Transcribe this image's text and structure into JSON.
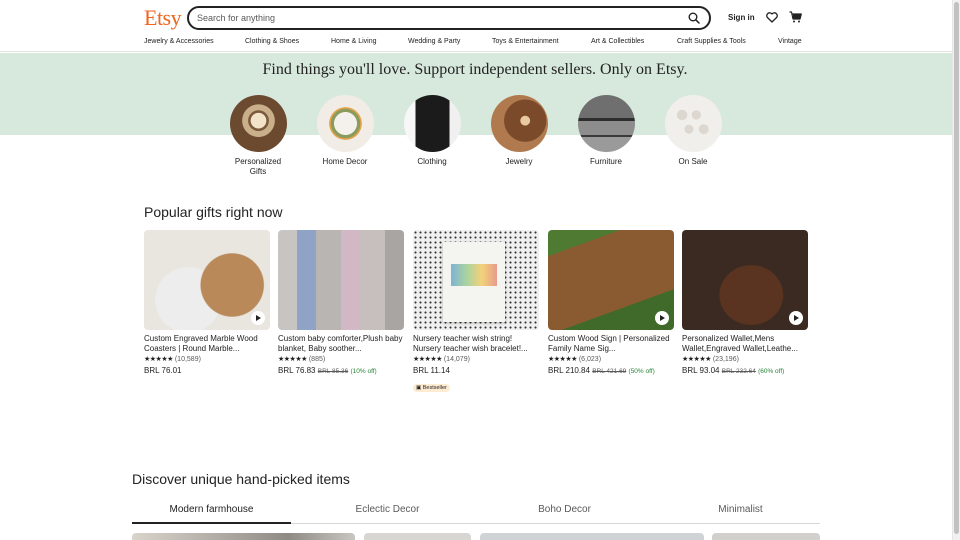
{
  "header": {
    "logo": "Etsy",
    "search_placeholder": "Search for anything",
    "sign_in": "Sign in",
    "nav": [
      "Jewelry & Accessories",
      "Clothing & Shoes",
      "Home & Living",
      "Wedding & Party",
      "Toys & Entertainment",
      "Art & Collectibles",
      "Craft Supplies & Tools",
      "Vintage"
    ]
  },
  "hero": {
    "title": "Find things you'll love. Support independent sellers. Only on Etsy.",
    "categories": [
      {
        "label": "Personalized Gifts"
      },
      {
        "label": "Home Decor"
      },
      {
        "label": "Clothing"
      },
      {
        "label": "Jewelry"
      },
      {
        "label": "Furniture"
      },
      {
        "label": "On Sale"
      }
    ]
  },
  "popular": {
    "title": "Popular gifts right now",
    "items": [
      {
        "title": "Custom Engraved Marble Wood Coasters | Round Marble...",
        "stars": "★★★★★",
        "reviews": "(10,589)",
        "price": "BRL 76.01",
        "original": "",
        "discount": "",
        "badge": ""
      },
      {
        "title": "Custom baby comforter,Plush baby blanket, Baby soother...",
        "stars": "★★★★★",
        "reviews": "(885)",
        "price": "BRL 76.83",
        "original": "BRL 85.36",
        "discount": "(10% off)",
        "badge": ""
      },
      {
        "title": "Nursery teacher wish string! Nursery teacher wish bracelet!...",
        "stars": "★★★★★",
        "reviews": "(14,079)",
        "price": "BRL 11.14",
        "original": "",
        "discount": "",
        "badge": "Bestseller"
      },
      {
        "title": "Custom Wood Sign | Personalized Family Name Sig...",
        "stars": "★★★★★",
        "reviews": "(6,023)",
        "price": "BRL 210.84",
        "original": "BRL 421.69",
        "discount": "(50% off)",
        "badge": ""
      },
      {
        "title": "Personalized Wallet,Mens Wallet,Engraved Wallet,Leathe...",
        "stars": "★★★★★",
        "reviews": "(23,196)",
        "price": "BRL 93.04",
        "original": "BRL 232.64",
        "discount": "(60% off)",
        "badge": ""
      }
    ]
  },
  "discover": {
    "title": "Discover unique hand-picked items",
    "tabs": [
      "Modern farmhouse",
      "Eclectic Decor",
      "Boho Decor",
      "Minimalist"
    ]
  },
  "colors": {
    "brand": "#f1641e",
    "hero_bg": "#d7e9dd",
    "discount": "#258635"
  }
}
